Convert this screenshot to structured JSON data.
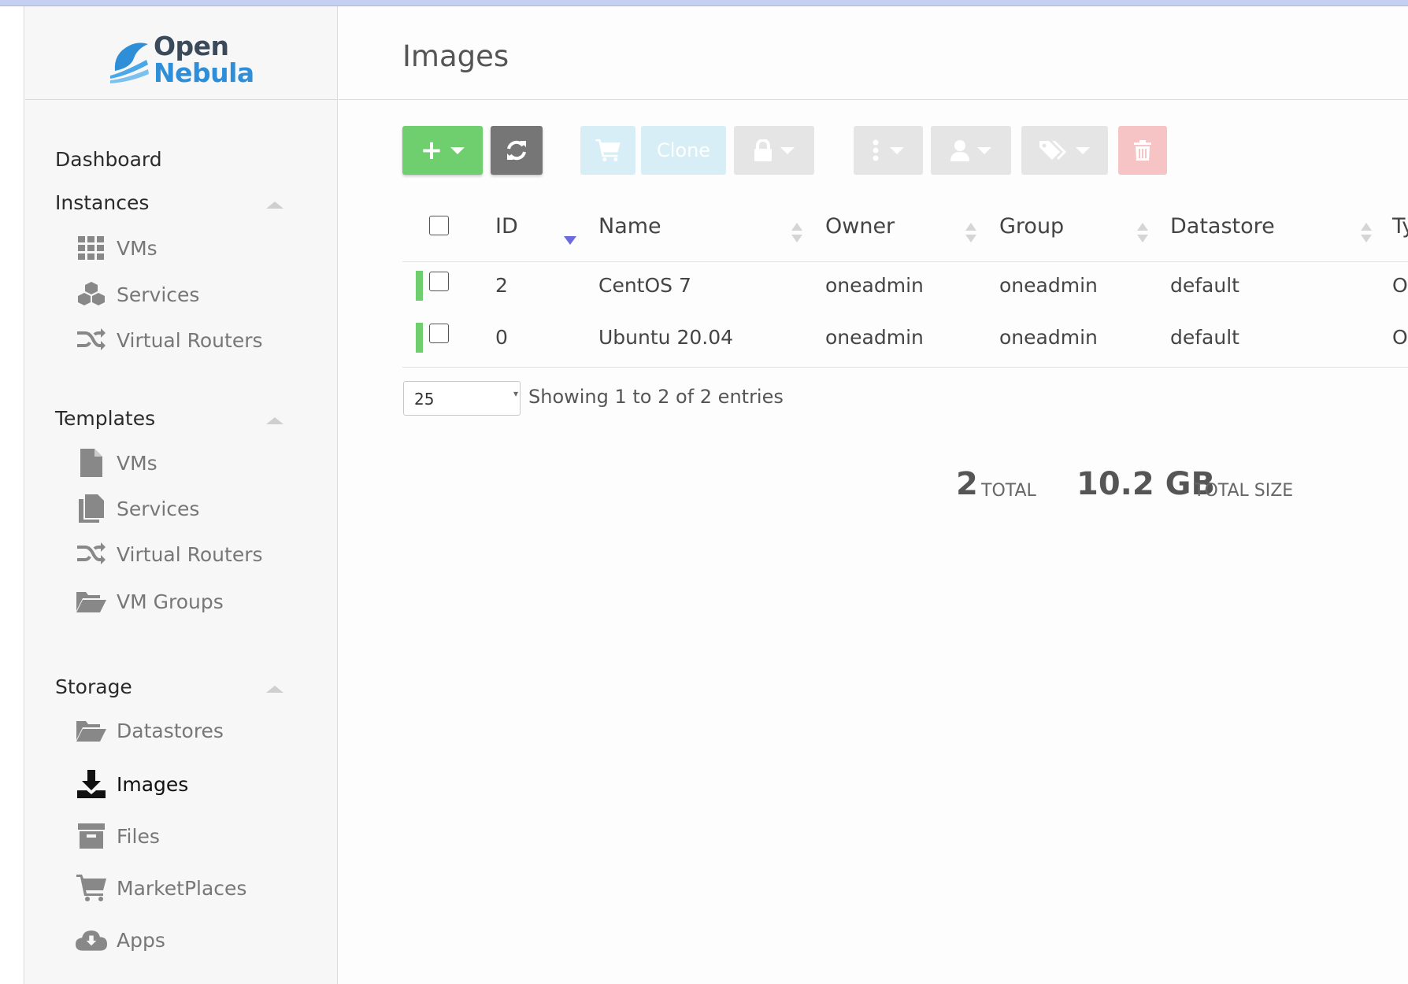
{
  "logo": {
    "line1": "Open",
    "line2": "Nebula"
  },
  "sidebar": {
    "dashboard": "Dashboard",
    "instances": {
      "title": "Instances",
      "items": [
        {
          "label": "VMs",
          "icon": "th-grid-icon"
        },
        {
          "label": "Services",
          "icon": "cubes-icon"
        },
        {
          "label": "Virtual Routers",
          "icon": "random-icon"
        }
      ]
    },
    "templates": {
      "title": "Templates",
      "items": [
        {
          "label": "VMs",
          "icon": "file-icon"
        },
        {
          "label": "Services",
          "icon": "files-icon"
        },
        {
          "label": "Virtual Routers",
          "icon": "random-icon"
        },
        {
          "label": "VM Groups",
          "icon": "folder-open-icon"
        }
      ]
    },
    "storage": {
      "title": "Storage",
      "items": [
        {
          "label": "Datastores",
          "icon": "folder-open-icon"
        },
        {
          "label": "Images",
          "icon": "download-icon",
          "active": true
        },
        {
          "label": "Files",
          "icon": "archive-icon"
        },
        {
          "label": "MarketPlaces",
          "icon": "shopping-cart-icon"
        },
        {
          "label": "Apps",
          "icon": "cloud-download-icon"
        }
      ]
    }
  },
  "header": {
    "title": "Images"
  },
  "toolbar": {
    "clone_label": "Clone"
  },
  "table": {
    "columns": [
      "ID",
      "Name",
      "Owner",
      "Group",
      "Datastore",
      "Ty"
    ],
    "rows": [
      {
        "id": "2",
        "name": "CentOS 7",
        "owner": "oneadmin",
        "group": "oneadmin",
        "datastore": "default",
        "type": "O"
      },
      {
        "id": "0",
        "name": "Ubuntu 20.04",
        "owner": "oneadmin",
        "group": "oneadmin",
        "datastore": "default",
        "type": "O"
      }
    ]
  },
  "pagination": {
    "page_size": "25",
    "showing": "Showing 1 to 2 of 2 entries"
  },
  "stats": {
    "total_value": "2",
    "total_label": "TOTAL",
    "size_value": "10.2 GB",
    "size_label": "TOTAL SIZE"
  },
  "colors": {
    "create": "#6fcf6f",
    "refresh": "#767676",
    "delete": "#f1aaaa",
    "active_status": "#6fcf6f"
  }
}
